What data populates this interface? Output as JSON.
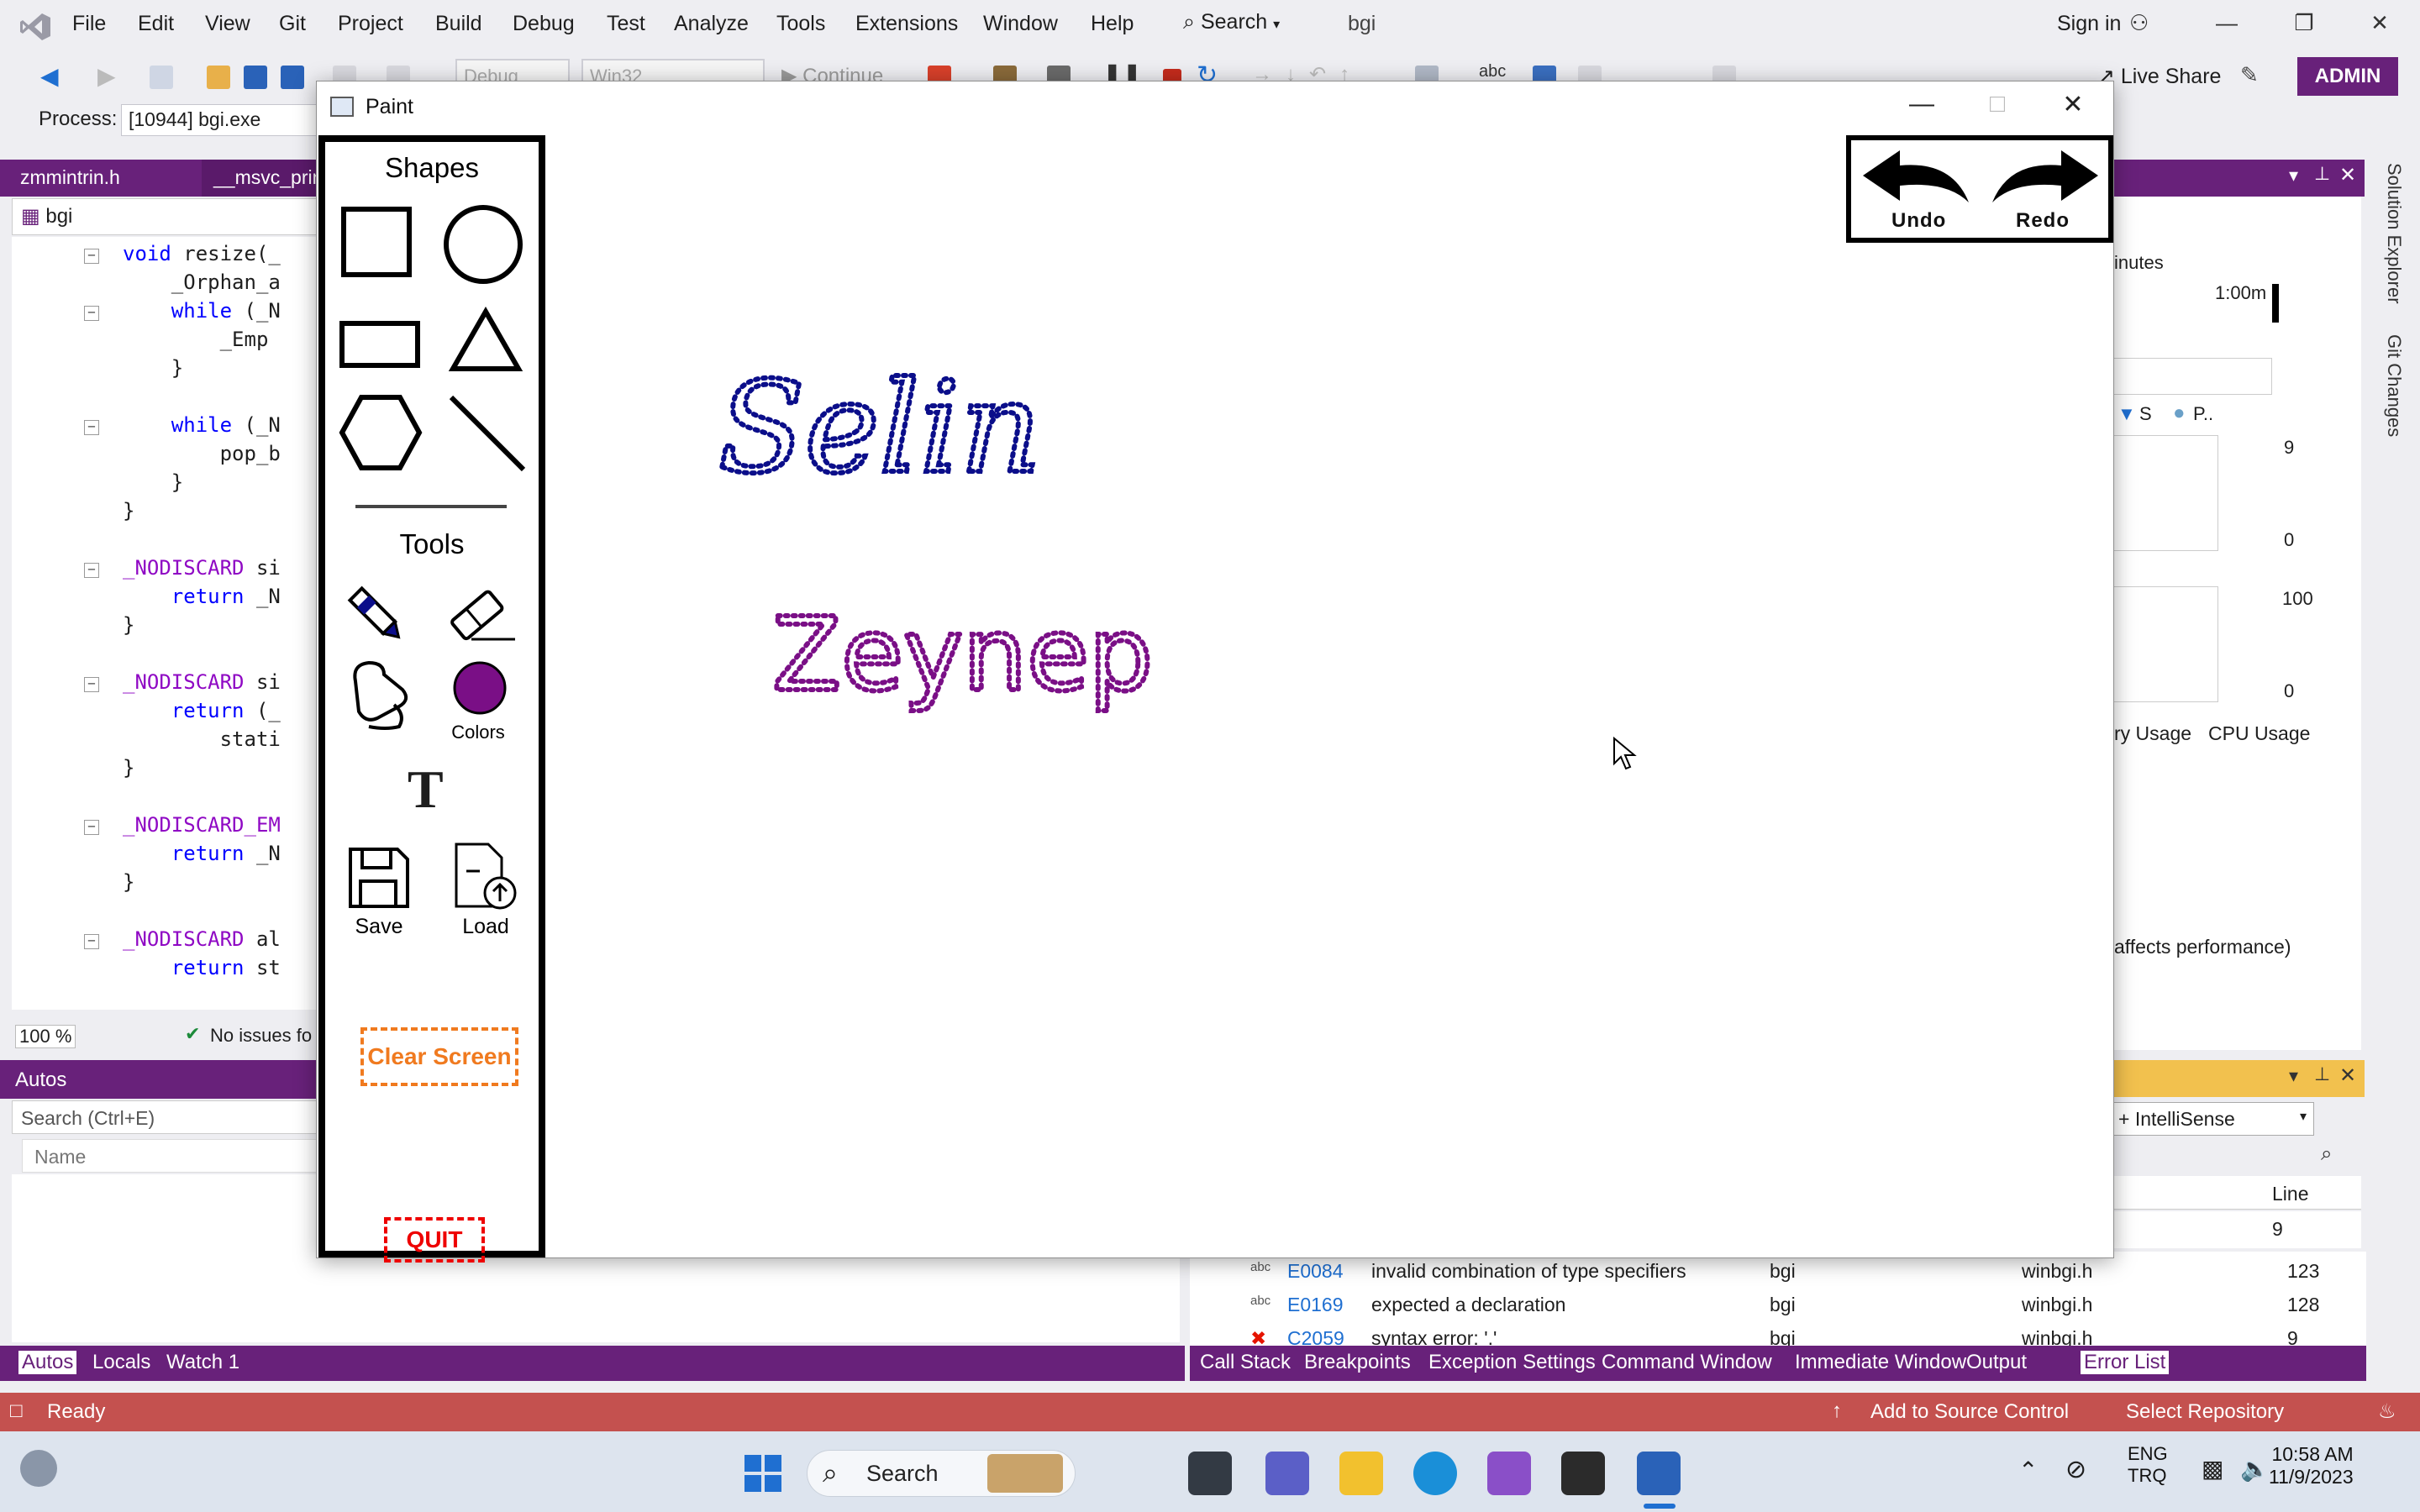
{
  "vs": {
    "menu": [
      "File",
      "Edit",
      "View",
      "Git",
      "Project",
      "Build",
      "Debug",
      "Test",
      "Analyze",
      "Tools",
      "Extensions",
      "Window",
      "Help"
    ],
    "search_label": "Search",
    "solution_name": "bgi",
    "sign_in": "Sign in",
    "live_share": "Live Share",
    "admin_badge": "ADMIN",
    "config_combo": "Debug",
    "platform_combo": "Win32",
    "continue_label": "Continue",
    "process_label": "Process:",
    "process_value": "[10944] bgi.exe",
    "editor_tabs": [
      "zmmintrin.h",
      "__msvc_prin"
    ],
    "editor_nav": "bgi",
    "code_lines": [
      {
        "indent": "",
        "pre": "void ",
        "text": "resize(_"
      },
      {
        "indent": "    ",
        "pre": "",
        "text": "_Orphan_a"
      },
      {
        "indent": "    ",
        "pre": "while ",
        "text": "(_N"
      },
      {
        "indent": "        ",
        "pre": "",
        "text": "_Emp"
      },
      {
        "indent": "    ",
        "pre": "",
        "text": "}"
      },
      {
        "indent": "",
        "pre": "",
        "text": ""
      },
      {
        "indent": "    ",
        "pre": "while ",
        "text": "(_N"
      },
      {
        "indent": "        ",
        "pre": "",
        "text": "pop_b"
      },
      {
        "indent": "    ",
        "pre": "",
        "text": "}"
      },
      {
        "indent": "",
        "pre": "",
        "text": "}"
      },
      {
        "indent": "",
        "pre": "",
        "text": ""
      },
      {
        "indent": "",
        "pre": "_NODISCARD ",
        "text": "si"
      },
      {
        "indent": "    ",
        "pre": "return ",
        "text": "_N"
      },
      {
        "indent": "",
        "pre": "",
        "text": "}"
      },
      {
        "indent": "",
        "pre": "",
        "text": ""
      },
      {
        "indent": "",
        "pre": "_NODISCARD ",
        "text": "si"
      },
      {
        "indent": "    ",
        "pre": "return ",
        "text": "(_"
      },
      {
        "indent": "        ",
        "pre": "",
        "text": "stati"
      },
      {
        "indent": "",
        "pre": "",
        "text": "}"
      },
      {
        "indent": "",
        "pre": "",
        "text": ""
      },
      {
        "indent": "",
        "pre": "_NODISCARD_EM",
        "text": ""
      },
      {
        "indent": "    ",
        "pre": "return ",
        "text": "_N"
      },
      {
        "indent": "",
        "pre": "",
        "text": "}"
      },
      {
        "indent": "",
        "pre": "",
        "text": ""
      },
      {
        "indent": "",
        "pre": "_NODISCARD ",
        "text": "al"
      },
      {
        "indent": "    ",
        "pre": "return ",
        "text": "st"
      }
    ],
    "zoom": "100 %",
    "issues": "No issues fo",
    "autos_title": "Autos",
    "autos_search_placeholder": "Search (Ctrl+E)",
    "autos_name_col": "Name",
    "bottom_tabs_left": [
      "Autos",
      "Locals",
      "Watch 1"
    ],
    "bottom_tabs_right": [
      "Call Stack",
      "Breakpoints",
      "Exception Settings",
      "Command Window",
      "Immediate Window",
      "Output",
      "Error List"
    ],
    "diag": {
      "minutes": "inutes",
      "time_mark": "1:00m",
      "legend_s": "S",
      "legend_p": "P..",
      "gc_max": "9",
      "gc_min": "0",
      "cpu_max": "100",
      "cpu_min": "0",
      "mem_tab": "ry Usage",
      "cpu_tab": "CPU Usage",
      "perf_note": "affects performance)",
      "vertical_tabs": [
        "Solution Explorer",
        "Git Changes"
      ]
    },
    "error_filter": "+ IntelliSense",
    "error_line_header": "Line",
    "error_rows": [
      {
        "code": "",
        "desc": "",
        "project": "",
        "file": "",
        "line": "9"
      },
      {
        "code": "E0084",
        "desc": "invalid combination of type specifiers",
        "project": "bgi",
        "file": "winbgi.h",
        "line": "123"
      },
      {
        "code": "E0169",
        "desc": "expected a declaration",
        "project": "bgi",
        "file": "winbgi.h",
        "line": "128"
      },
      {
        "code": "C2059",
        "desc": "syntax error: '.'",
        "project": "bgi",
        "file": "winbgi.h",
        "line": "9"
      }
    ],
    "status": {
      "ready": "Ready",
      "source_control": "Add to Source Control",
      "repository": "Select Repository"
    }
  },
  "paint": {
    "title": "Paint",
    "shapes_heading": "Shapes",
    "tools_heading": "Tools",
    "colors_label": "Colors",
    "text_tool_glyph": "T",
    "save_label": "Save",
    "load_label": "Load",
    "clear_label": "Clear Screen",
    "quit_label": "QUIT",
    "undo_label": "Undo",
    "redo_label": "Redo",
    "current_color": "#7a0f86",
    "drawings": [
      {
        "text": "Selin",
        "color": "#0b0e8a"
      },
      {
        "text": "Zeynep",
        "color": "#7a0f86"
      }
    ]
  },
  "taskbar": {
    "search_label": "Search",
    "lang_top": "ENG",
    "lang_bottom": "TRQ",
    "time": "10:58 AM",
    "date": "11/9/2023"
  }
}
